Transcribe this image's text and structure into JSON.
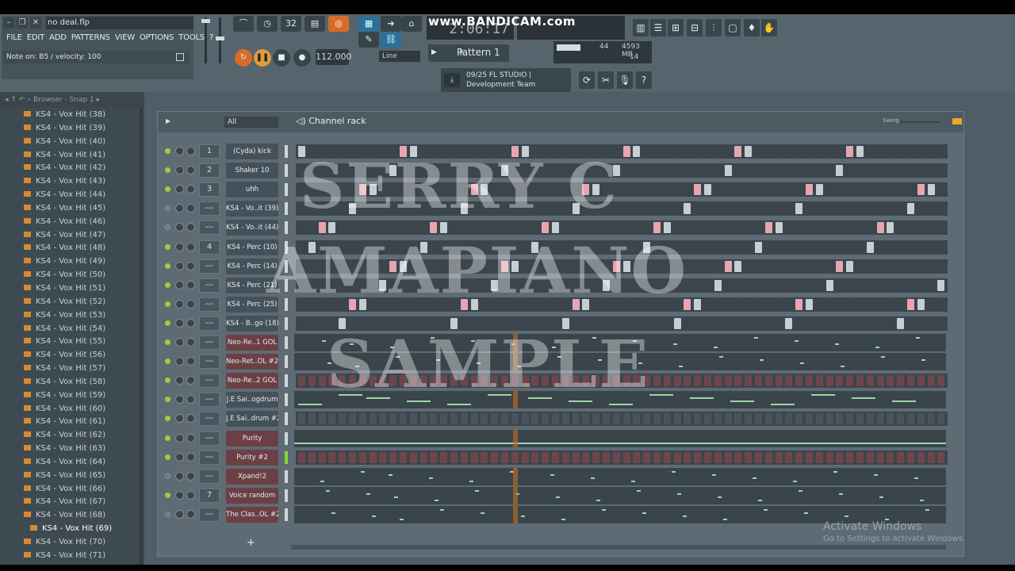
{
  "window": {
    "filename": "no deal.flp",
    "controls": [
      "–",
      "❐",
      "✕"
    ]
  },
  "menu": [
    "FILE",
    "EDIT",
    "ADD",
    "PATTERNS",
    "VIEW",
    "OPTIONS",
    "TOOLS",
    "?"
  ],
  "hint": "Note on: B5 / velocity: 100",
  "transport": {
    "tempo": "112.000",
    "time": "2:06:17",
    "snap": "Line",
    "pattern": "Pattern 1",
    "pattern_number": "32",
    "recording_label": "www.BANDICAM.com"
  },
  "cpu": {
    "polyphony": "44",
    "memory": "4593 MB",
    "voices": "14"
  },
  "news": {
    "line1": "09/25  FL STUDIO |",
    "line2": "Development Team"
  },
  "browser": {
    "header": "Browser - Snap 1",
    "items": [
      "KS4 - Vox Hit (38)",
      "KS4 - Vox Hit (39)",
      "KS4 - Vox Hit (40)",
      "KS4 - Vox Hit (41)",
      "KS4 - Vox Hit (42)",
      "KS4 - Vox Hit (43)",
      "KS4 - Vox Hit (44)",
      "KS4 - Vox Hit (45)",
      "KS4 - Vox Hit (46)",
      "KS4 - Vox Hit (47)",
      "KS4 - Vox Hit (48)",
      "KS4 - Vox Hit (49)",
      "KS4 - Vox Hit (50)",
      "KS4 - Vox Hit (51)",
      "KS4 - Vox Hit (52)",
      "KS4 - Vox Hit (53)",
      "KS4 - Vox Hit (54)",
      "KS4 - Vox Hit (55)",
      "KS4 - Vox Hit (56)",
      "KS4 - Vox Hit (57)",
      "KS4 - Vox Hit (58)",
      "KS4 - Vox Hit (59)",
      "KS4 - Vox Hit (60)",
      "KS4 - Vox Hit (61)",
      "KS4 - Vox Hit (62)",
      "KS4 - Vox Hit (63)",
      "KS4 - Vox Hit (64)",
      "KS4 - Vox Hit (65)",
      "KS4 - Vox Hit (66)",
      "KS4 - Vox Hit (67)",
      "KS4 - Vox Hit (68)",
      "KS4 - Vox Hit (69)",
      "KS4 - Vox Hit (70)",
      "KS4 - Vox Hit (71)"
    ],
    "selected": "KS4 - Vox Hit (69)"
  },
  "rack": {
    "title": "Channel rack",
    "filter": "All",
    "swing_label": "Swing",
    "add_label": "+",
    "channels": [
      {
        "num": "1",
        "name": "(Cyda) kick",
        "type": "steps",
        "red": false,
        "on": true
      },
      {
        "num": "2",
        "name": "Shaker 10",
        "type": "steps",
        "red": false,
        "on": true
      },
      {
        "num": "3",
        "name": "uhh",
        "type": "steps",
        "red": false,
        "on": true
      },
      {
        "num": "---",
        "name": "KS4 - Vo..it (39)",
        "type": "steps",
        "red": false,
        "on": false
      },
      {
        "num": "---",
        "name": "KS4 - Vo..it (44)",
        "type": "steps",
        "red": false,
        "on": false
      },
      {
        "num": "4",
        "name": "KS4 - Perc (10)",
        "type": "steps",
        "red": false,
        "on": true
      },
      {
        "num": "---",
        "name": "KS4 - Perc (14)",
        "type": "steps",
        "red": false,
        "on": true
      },
      {
        "num": "---",
        "name": "KS4 - Perc (21)",
        "type": "steps",
        "red": false,
        "on": true
      },
      {
        "num": "---",
        "name": "KS4 - Perc (25)",
        "type": "steps",
        "red": false,
        "on": true
      },
      {
        "num": "---",
        "name": "KS4 - B..go (18)",
        "type": "steps",
        "red": false,
        "on": true
      },
      {
        "num": "---",
        "name": "Neo-Re..1 GOL",
        "type": "roll",
        "red": true,
        "on": true
      },
      {
        "num": "---",
        "name": "Neo-Ret..OL #2",
        "type": "roll",
        "red": true,
        "on": true
      },
      {
        "num": "---",
        "name": "Neo-Re..2 GOL",
        "type": "steps",
        "red": true,
        "on": true
      },
      {
        "num": "---",
        "name": "J.E Sai..ogdrum",
        "type": "roll",
        "red": false,
        "on": true
      },
      {
        "num": "---",
        "name": "J.E Sai..drum #2",
        "type": "steps",
        "red": false,
        "on": true
      },
      {
        "num": "---",
        "name": "Purity",
        "type": "roll",
        "red": true,
        "on": true
      },
      {
        "num": "---",
        "name": "Purity #2",
        "type": "steps",
        "red": true,
        "on": true
      },
      {
        "num": "---",
        "name": "Xpand!2",
        "type": "roll",
        "red": true,
        "on": false
      },
      {
        "num": "7",
        "name": "Voice random",
        "type": "roll",
        "red": true,
        "on": true
      },
      {
        "num": "---",
        "name": "The Clas..OL #2",
        "type": "roll",
        "red": true,
        "on": false
      }
    ]
  },
  "watermark": {
    "line1": "SERRY C",
    "line2": "AMAPIANO",
    "line3": "SAMPLE"
  },
  "activation": {
    "line1": "Activate Windows",
    "line2": "Go to Settings to activate Windows."
  },
  "colors": {
    "accent": "#d96b2a",
    "step_on": "#c6ced3",
    "step_pink": "#e8a5ad",
    "step_off": "#3b454b",
    "note": "#9ed7a8"
  }
}
